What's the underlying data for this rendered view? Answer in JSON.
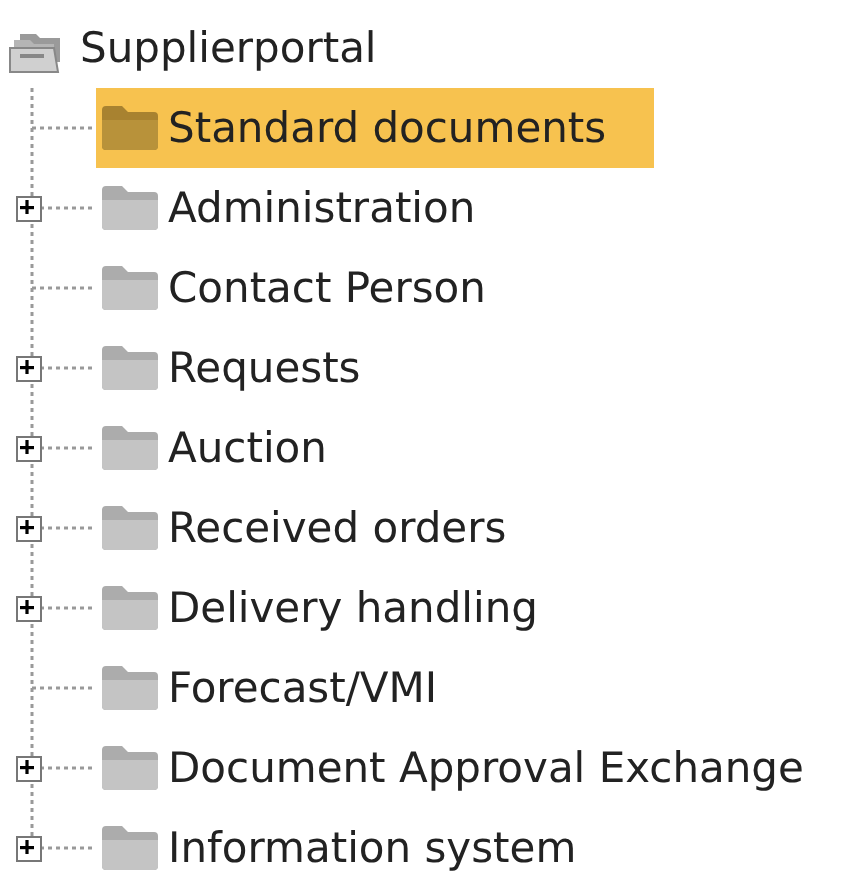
{
  "tree": {
    "label": "Supplierportal",
    "children": [
      {
        "label": "Standard documents",
        "kind": "leaf",
        "selected": true
      },
      {
        "label": "Administration",
        "kind": "branch",
        "expanded": false,
        "selected": false
      },
      {
        "label": "Contact Person",
        "kind": "leaf",
        "selected": false
      },
      {
        "label": "Requests",
        "kind": "branch",
        "expanded": false,
        "selected": false
      },
      {
        "label": "Auction",
        "kind": "branch",
        "expanded": false,
        "selected": false
      },
      {
        "label": "Received orders",
        "kind": "branch",
        "expanded": false,
        "selected": false
      },
      {
        "label": "Delivery handling",
        "kind": "branch",
        "expanded": false,
        "selected": false
      },
      {
        "label": "Forecast/VMI",
        "kind": "leaf",
        "selected": false
      },
      {
        "label": "Document Approval Exchange",
        "kind": "branch",
        "expanded": false,
        "selected": false
      },
      {
        "label": "Information system",
        "kind": "branch",
        "expanded": false,
        "selected": false
      }
    ]
  }
}
